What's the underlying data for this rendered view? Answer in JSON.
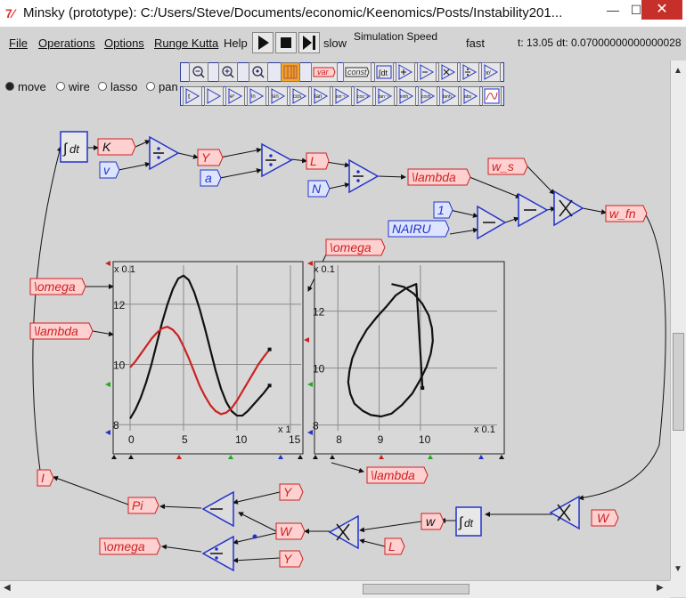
{
  "window": {
    "title": "Minsky (prototype): C:/Users/Steve/Documents/economic/Keenomics/Posts/Instability201...",
    "icon": "tk-feather-icon",
    "minimize_label": "—",
    "maximize_label": "☐",
    "close_label": "✕"
  },
  "menubar": {
    "items": [
      "File",
      "Operations",
      "Options",
      "Runge Kutta",
      "Help"
    ],
    "play_icon": "play-icon",
    "stop_icon": "stop-icon",
    "step_icon": "step-icon",
    "slow_label": "slow",
    "speed_label": "Simulation Speed",
    "fast_label": "fast",
    "speed_value": 0.9,
    "status": "t: 13.05 dt: 0.07000000000000028"
  },
  "modes": {
    "options": [
      "move",
      "wire",
      "lasso",
      "pan"
    ],
    "selected": "move"
  },
  "toolbar": {
    "row1": [
      "zoom-out",
      "zoom-in",
      "zoom-reset",
      "godley-table",
      "var",
      "const",
      "integral",
      "add",
      "subtract",
      "multiply",
      "divide",
      "pow"
    ],
    "var_label": "var",
    "const_label": "const",
    "row2": [
      "time",
      "copy",
      "exp",
      "ln",
      "sin",
      "cos",
      "tan",
      "asin",
      "acos",
      "atan",
      "sinh",
      "cosh",
      "tanh",
      "abs",
      "plot"
    ]
  },
  "canvas": {
    "vars": {
      "K": "K",
      "v": "v",
      "Y": "Y",
      "a": "a",
      "L": "L",
      "N": "N",
      "lambda": "\\lambda",
      "w_s": "w_s",
      "one": "1",
      "NAIRU": "NAIRU",
      "w_fn": "w_fn",
      "omega": "\\omega",
      "omega_plot": "\\omega",
      "lambda_plot": "\\lambda",
      "omega_xy": "\\omega",
      "lambda_xy": "\\lambda",
      "I": "I",
      "Pi": "Pi",
      "Y_b1": "Y",
      "W": "W",
      "L_b": "L",
      "w_b": "w",
      "W_right": "W",
      "omega_b": "\\omega",
      "Y_b2": "Y"
    },
    "integral_label": "dt",
    "colors": {
      "variable_fill": "#ffd0d0",
      "variable_border": "#cc2222",
      "parameter_border": "#2233cc",
      "operator_border": "#2233cc",
      "wire": "#111111"
    }
  },
  "chart_data": [
    {
      "type": "line",
      "title": "",
      "xlabel": "",
      "ylabel": "",
      "x_multiplier": "x 1",
      "y_multiplier": "x 0.1",
      "xlim": [
        0,
        15
      ],
      "ylim": [
        7.8,
        13
      ],
      "xticks": [
        "0",
        "5",
        "10",
        "15"
      ],
      "yticks": [
        "8",
        "10",
        "12"
      ],
      "grid": true,
      "series": [
        {
          "color": "#111111",
          "x": [
            0,
            0.5,
            1,
            1.5,
            2,
            2.5,
            3,
            3.5,
            4,
            4.5,
            5,
            5.5,
            6,
            6.5,
            7,
            7.5,
            8,
            8.5,
            9,
            9.5,
            10,
            10.5,
            11,
            11.5,
            12,
            12.5,
            13.05
          ],
          "y": [
            8.2,
            8.5,
            8.9,
            9.4,
            10.0,
            10.7,
            11.4,
            12.0,
            12.5,
            12.85,
            12.95,
            12.8,
            12.4,
            11.85,
            11.2,
            10.5,
            9.8,
            9.2,
            8.75,
            8.45,
            8.3,
            8.3,
            8.45,
            8.65,
            8.85,
            9.05,
            9.3
          ]
        },
        {
          "color": "#cc2222",
          "x": [
            0,
            0.5,
            1,
            1.5,
            2,
            2.5,
            3,
            3.5,
            4,
            4.5,
            5,
            5.5,
            6,
            6.5,
            7,
            7.5,
            8,
            8.5,
            9,
            9.5,
            10,
            10.5,
            11,
            11.5,
            12,
            12.5,
            13.05
          ],
          "y": [
            9.9,
            10.1,
            10.35,
            10.6,
            10.85,
            11.05,
            11.2,
            11.25,
            11.15,
            10.95,
            10.6,
            10.2,
            9.75,
            9.3,
            8.95,
            8.65,
            8.45,
            8.35,
            8.4,
            8.55,
            8.8,
            9.1,
            9.4,
            9.7,
            10.0,
            10.25,
            10.5
          ]
        }
      ]
    },
    {
      "type": "line",
      "title": "",
      "xlabel": "",
      "ylabel": "",
      "x_multiplier": "x 0.1",
      "y_multiplier": "x 0.1",
      "xlim": [
        7.8,
        11.6
      ],
      "ylim": [
        7.8,
        13.3
      ],
      "xticks": [
        "8",
        "9",
        "10"
      ],
      "yticks": [
        "8",
        "10",
        "12"
      ],
      "grid": true,
      "series": [
        {
          "color": "#111111",
          "x": [
            9.3,
            9.6,
            9.85,
            10.05,
            10.2,
            10.28,
            10.3,
            10.25,
            10.15,
            10.0,
            9.8,
            9.55,
            9.3,
            9.05,
            8.8,
            8.6,
            8.4,
            8.3,
            8.25,
            8.28,
            8.35,
            8.5,
            8.7,
            8.95,
            9.2,
            9.4,
            9.65,
            9.9,
            10.05
          ],
          "y": [
            12.95,
            12.85,
            12.6,
            12.25,
            11.85,
            11.4,
            10.95,
            10.5,
            10.05,
            9.6,
            9.1,
            8.7,
            8.4,
            8.3,
            8.35,
            8.5,
            8.75,
            9.1,
            9.5,
            9.9,
            10.35,
            10.85,
            11.35,
            11.8,
            12.2,
            12.55,
            12.8,
            12.95,
            9.3
          ]
        }
      ]
    }
  ]
}
